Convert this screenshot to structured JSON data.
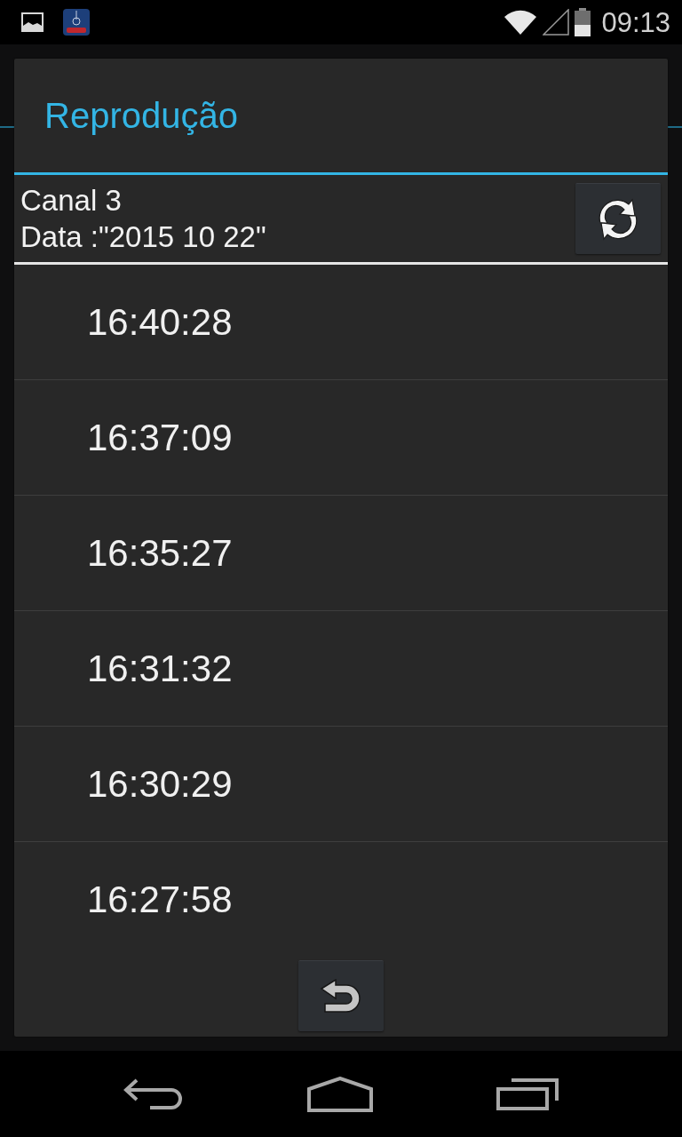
{
  "status_bar": {
    "time": "09:13"
  },
  "dialog": {
    "title": "Reprodução",
    "channel": "Canal 3",
    "date": "Data :\"2015 10 22\"",
    "recordings": [
      {
        "time": "16:40:28"
      },
      {
        "time": "16:37:09"
      },
      {
        "time": "16:35:27"
      },
      {
        "time": "16:31:32"
      },
      {
        "time": "16:30:29"
      },
      {
        "time": "16:27:58"
      }
    ]
  }
}
